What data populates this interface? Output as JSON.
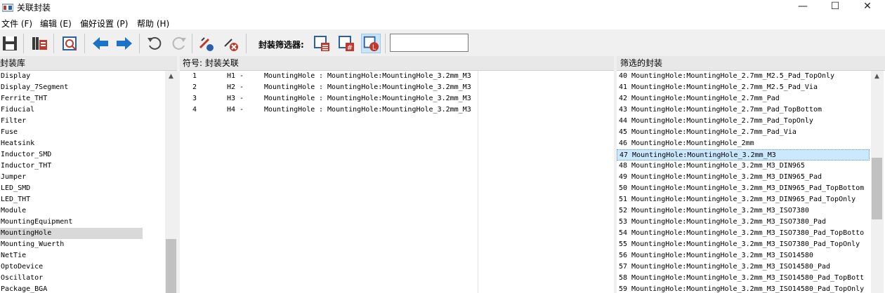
{
  "window": {
    "title": "关联封装",
    "minimize": "—",
    "maximize": "☐",
    "close": "✕"
  },
  "menu": [
    "文件 (F)",
    "编辑 (E)",
    "偏好设置 (P)",
    "帮助 (H)"
  ],
  "toolbar": {
    "filter_label": "封装筛选器:",
    "search_value": "",
    "icons": [
      "save-icon",
      "library-icon",
      "view-footprint-icon",
      "previous-icon",
      "next-icon",
      "undo-icon",
      "redo-icon",
      "auto-associate-icon",
      "delete-associations-icon",
      "filter-by-keywords-icon",
      "filter-by-pin-count-icon",
      "filter-by-library-icon"
    ]
  },
  "panels": {
    "libraries": {
      "header": "封装库",
      "items": [
        "Display",
        "Display_7Segment",
        "Ferrite_THT",
        "Fiducial",
        "Filter",
        "Fuse",
        "Heatsink",
        "Inductor_SMD",
        "Inductor_THT",
        "Jumper",
        "LED_SMD",
        "LED_THT",
        "Module",
        "MountingEquipment",
        "MountingHole",
        "Mounting_Wuerth",
        "NetTie",
        "OptoDevice",
        "Oscillator",
        "Package_BGA"
      ],
      "selected": "MountingHole"
    },
    "associations": {
      "header": "符号: 封装关联",
      "rows": [
        {
          "num": "1",
          "ref": "H1 -",
          "value": "MountingHole",
          "footprint": ": MountingHole:MountingHole_3.2mm_M3"
        },
        {
          "num": "2",
          "ref": "H2 -",
          "value": "MountingHole",
          "footprint": ": MountingHole:MountingHole_3.2mm_M3"
        },
        {
          "num": "3",
          "ref": "H3 -",
          "value": "MountingHole",
          "footprint": ": MountingHole:MountingHole_3.2mm_M3"
        },
        {
          "num": "4",
          "ref": "H4 -",
          "value": "MountingHole",
          "footprint": ": MountingHole:MountingHole_3.2mm_M3"
        }
      ]
    },
    "filtered": {
      "header": "筛选的封装",
      "items": [
        "40 MountingHole:MountingHole_2.7mm_M2.5_Pad_TopOnly",
        "41 MountingHole:MountingHole_2.7mm_M2.5_Pad_Via",
        "42 MountingHole:MountingHole_2.7mm_Pad",
        "43 MountingHole:MountingHole_2.7mm_Pad_TopBottom",
        "44 MountingHole:MountingHole_2.7mm_Pad_TopOnly",
        "45 MountingHole:MountingHole_2.7mm_Pad_Via",
        "46 MountingHole:MountingHole_2mm",
        "47 MountingHole:MountingHole_3.2mm_M3",
        "48 MountingHole:MountingHole_3.2mm_M3_DIN965",
        "49 MountingHole:MountingHole_3.2mm_M3_DIN965_Pad",
        "50 MountingHole:MountingHole_3.2mm_M3_DIN965_Pad_TopBottom",
        "51 MountingHole:MountingHole_3.2mm_M3_DIN965_Pad_TopOnly",
        "52 MountingHole:MountingHole_3.2mm_M3_ISO7380",
        "53 MountingHole:MountingHole_3.2mm_M3_ISO7380_Pad",
        "54 MountingHole:MountingHole_3.2mm_M3_ISO7380_Pad_TopBotto",
        "55 MountingHole:MountingHole_3.2mm_M3_ISO7380_Pad_TopOnly",
        "56 MountingHole:MountingHole_3.2mm_M3_ISO14580",
        "57 MountingHole:MountingHole_3.2mm_M3_ISO14580_Pad",
        "58 MountingHole:MountingHole_3.2mm_M3_ISO14580_Pad_TopBott",
        "59 MountingHole:MountingHole_3.2mm_M3_ISO14580_Pad_TopOnly"
      ],
      "selected": "47 MountingHole:MountingHole_3.2mm_M3"
    }
  },
  "colors": {
    "accent_blue": "#1a73c8",
    "selection_blue": "#cce8ff",
    "library_selected": "#d9d9d9"
  }
}
